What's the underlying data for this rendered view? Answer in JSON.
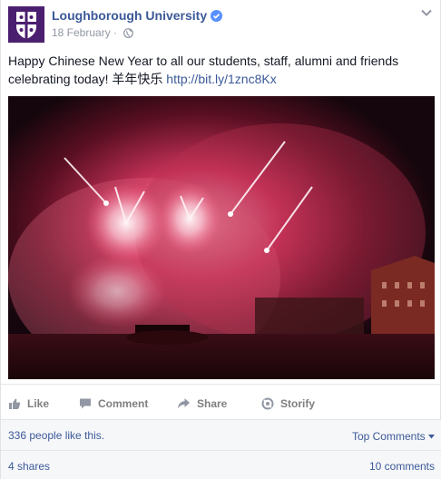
{
  "post": {
    "page_name": "Loughborough University",
    "date": "18 February",
    "meta_sep": "·",
    "text_main": "Happy Chinese New Year to all our students, staff, alumni and friends celebrating today! 羊年快乐 ",
    "link": "http://bit.ly/1znc8Kx"
  },
  "icons": {
    "verified": "verified-badge-icon",
    "audience": "globe-icon",
    "menu": "chevron-down-icon"
  },
  "actions": {
    "like": "Like",
    "comment": "Comment",
    "share": "Share",
    "storify": "Storify"
  },
  "stats": {
    "likes": "336 people like this.",
    "top_comments": "Top Comments",
    "shares": "4 shares",
    "comments": "10 comments"
  },
  "colors": {
    "link": "#3b5998",
    "muted": "#9197a3",
    "brand": "#4b1f6f"
  }
}
